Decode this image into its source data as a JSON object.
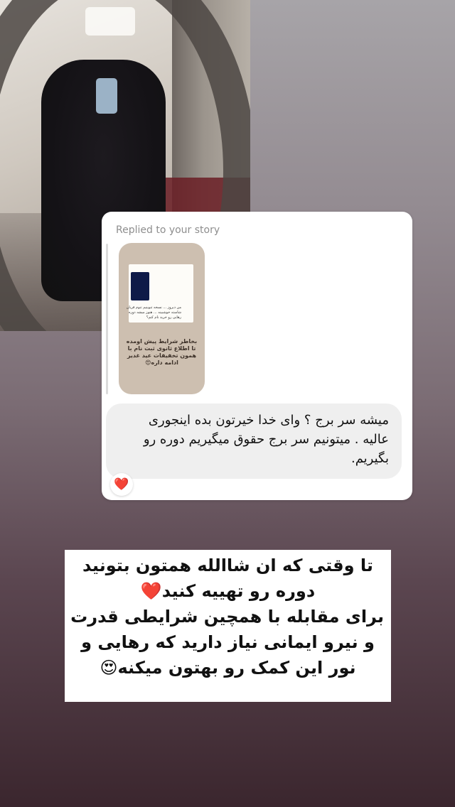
{
  "reply_card": {
    "header": "Replied to your story",
    "story_thumbnail": {
      "inner_message": "من دیروز ... نسخه تنوینیم تنوم قربان شاسته خوشبینه ... هنوز میشه دوره رهایی رو خرید نام کنم؟",
      "caption": "بخاطر شرایط پیش اومده تا اطلاع ثانوی ثبت نام با همون تخفیفات عید غدیر ادامه داره😍"
    },
    "message": "میشه سر برج ؟ وای خدا خیرتون بده اینجوری عالیه . میتونیم سر برج حقوق میگیریم دوره رو بگیریم.",
    "reaction": "❤️"
  },
  "story_caption": {
    "lines": [
      "تا وقتی که ان شاالله همتون بتونید",
      "دوره رو تهییه کنید❤️",
      "برای مقابله با همچین شرایطی قدرت",
      "و نیرو ایمانی نیاز دارید که رهایی و",
      "نور این کمک رو بهتون میکنه😍"
    ]
  }
}
